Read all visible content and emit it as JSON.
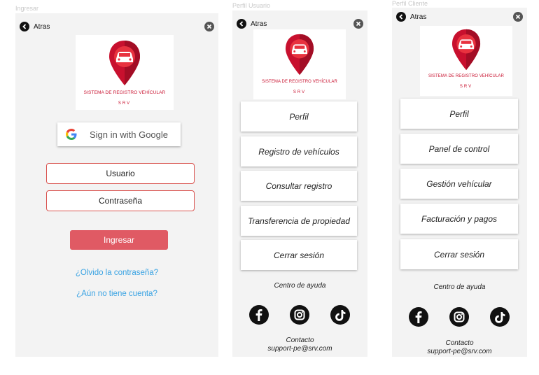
{
  "frames": [
    {
      "title": "Ingresar"
    },
    {
      "title": "Perfil Usuario"
    },
    {
      "title": "Perfil Cliente"
    }
  ],
  "common": {
    "back_label": "Atras",
    "logo_title": "SISTEMA DE REGISTRO VEHÍCULAR",
    "logo_abbr": "SRV",
    "help_label": "Centro de ayuda",
    "contact_label": "Contacto",
    "contact_email": "support-pe@srv.com",
    "brand_color": "#c8102e",
    "accent_color": "#e05a64",
    "link_color": "#3aa3e3"
  },
  "login": {
    "google_label": "Sign in with Google",
    "user_label": "Usuario",
    "password_label": "Contraseña",
    "submit_label": "Ingresar",
    "forgot_label": "¿Olvido la contraseña?",
    "no_account_label": "¿Aún no tiene cuenta?"
  },
  "user_menu": [
    "Perfil",
    "Registro de vehículos",
    "Consultar registro",
    "Transferencia de propiedad",
    "Cerrar sesión"
  ],
  "client_menu": [
    "Perfil",
    "Panel de control",
    "Gestión vehícular",
    "Facturación y pagos",
    "Cerrar sesión"
  ],
  "social_icons": [
    "facebook-icon",
    "instagram-icon",
    "tiktok-icon"
  ]
}
